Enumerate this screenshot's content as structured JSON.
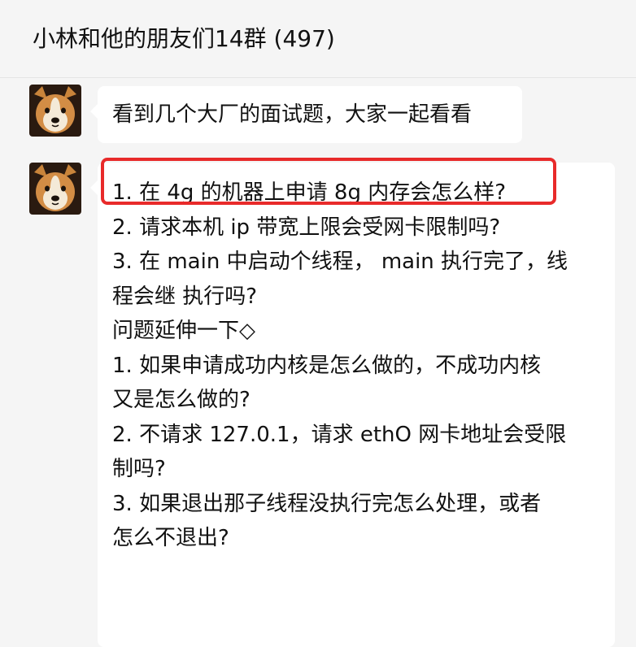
{
  "header": {
    "title": "小林和他的朋友们14群 (497)"
  },
  "messages": [
    {
      "avatar_icon": "shiba-dog-avatar-icon",
      "text": "看到几个大厂的面试题，大家一起看看"
    },
    {
      "avatar_icon": "shiba-dog-avatar-icon",
      "lines": [
        "1.  在 4g 的机器上申请 8g 内存会怎么样?",
        "2.  请求本机 ip 带宽上限会受网卡限制吗?",
        "3.  在 main 中启动个线程， main 执行完了，线",
        "程会继 执行吗?",
        "问题延伸一下◇",
        "1.  如果申请成功内核是怎么做的，不成功内核",
        "又是怎么做的?",
        "2.  不请求 127.0.1，请求 ethO 网卡地址会受限",
        "制吗?",
        "3.  如果退出那子线程没执行完怎么处理，或者",
        "怎么不退出?"
      ]
    }
  ],
  "colors": {
    "background": "#f5f5f5",
    "bubble": "#ffffff",
    "highlight_border": "#e82a2a"
  }
}
